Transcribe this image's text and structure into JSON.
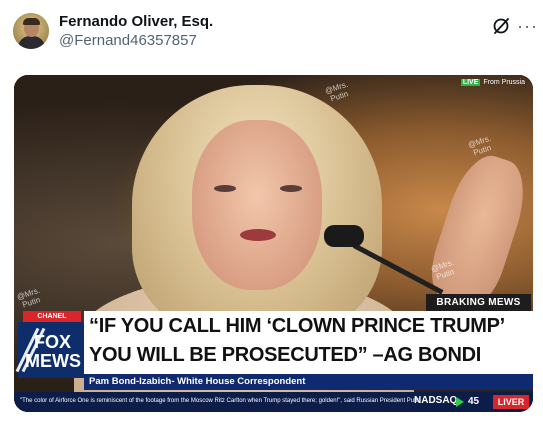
{
  "author": {
    "name": "Fernando Oliver, Esq.",
    "handle": "@Fernand46357857"
  },
  "icons": {
    "grok": "grok-icon",
    "more": "more-options-icon"
  },
  "media": {
    "watermark": "@Mrs.\nPutin",
    "live_badge": {
      "live": "LIVE",
      "text": "From Prussia"
    },
    "braking_label": "BRAKING MEWS",
    "channel_label": "CHANEL",
    "logo": {
      "line1": "FOX",
      "line2": "MEWS"
    },
    "headline_line1": "“IF YOU CALL HIM ‘CLOWN PRINCE TRUMP’",
    "headline_line2": "YOU WILL BE PROSECUTED” –AG BONDI",
    "subtitle": "Pam Bond-Izabich-  White House Correspondent",
    "ticker": "\"The color of Airforce One is reminiscent of the footage from the Moscow Ritz Carlton when Trump stayed there; golden!\", said Russian President Putin",
    "nasdaq_label": "NADSAQ",
    "nasdaq_value": "45",
    "liver_label": "LIVER"
  },
  "colors": {
    "fox_blue": "#0d2e6b",
    "fox_red": "#d8262a",
    "ticker_up": "#2fcf4a"
  }
}
